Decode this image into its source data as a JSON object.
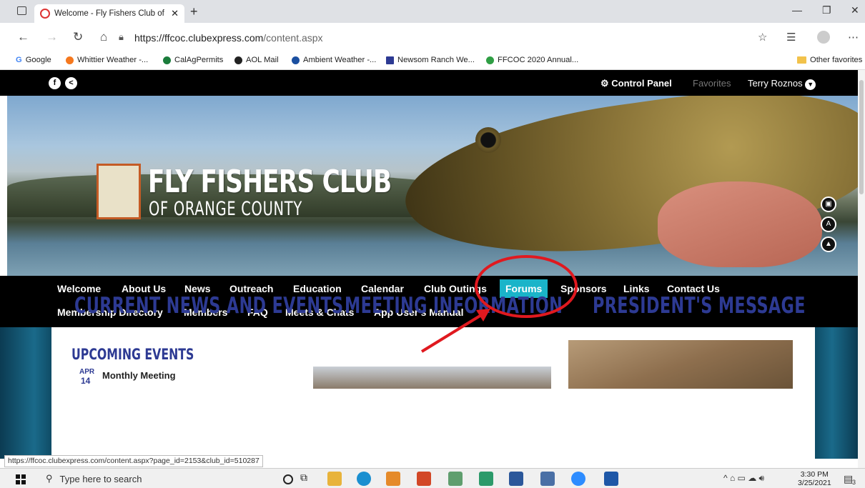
{
  "browser": {
    "tab_title": "Welcome - Fly Fishers Club of Or",
    "tab_close": "✕",
    "new_tab": "+",
    "url_host": "https://ffcoc.clubexpress.com",
    "url_path": "/content.aspx",
    "status_url": "https://ffcoc.clubexpress.com/content.aspx?page_id=2153&club_id=510287",
    "favorites": [
      {
        "label": "Google",
        "color": "#4285f4"
      },
      {
        "label": "Whittier Weather -...",
        "color": "#f5781e"
      },
      {
        "label": "CalAgPermits",
        "color": "#1a7c3b"
      },
      {
        "label": "AOL Mail",
        "color": "#222222"
      },
      {
        "label": "Ambient Weather -...",
        "color": "#1b4fa0"
      },
      {
        "label": "Newsom Ranch We...",
        "color": "#2d3a93"
      },
      {
        "label": "FFCOC 2020 Annual...",
        "color": "#2f9e44"
      }
    ],
    "other_favorites": "Other favorites"
  },
  "site": {
    "util": {
      "control_panel": "⚙ Control Panel",
      "favorites": "Favorites",
      "user": "Terry Roznos"
    },
    "logo_title": "FLY FISHERS CLUB",
    "logo_sub": "OF ORANGE COUNTY",
    "nav_row1": [
      "Welcome",
      "About Us",
      "News",
      "Outreach",
      "Education",
      "Calendar",
      "Club Outings",
      "Forums",
      "Sponsors",
      "Links",
      "Contact Us"
    ],
    "nav_row2": [
      "Membership Directory",
      "Members",
      "FAQ",
      "Meets & Chats",
      "App User's Manual"
    ],
    "active_nav": "Forums",
    "sections": {
      "news": "CURRENT NEWS AND EVENTS",
      "meeting": "MEETING INFORMATION",
      "president": "PRESIDENT'S MESSAGE"
    },
    "upcoming_events": "UPCOMING EVENTS",
    "event": {
      "month": "APR",
      "day": "14",
      "title": "Monthly Meeting"
    }
  },
  "taskbar": {
    "search_placeholder": "Type here to search",
    "time": "3:30 PM",
    "date": "3/25/2021",
    "notification_count": "3"
  },
  "colors": {
    "accent_nav": "#1ab4c9",
    "heading_blue": "#2d3a93",
    "annotation_red": "#e0191f"
  }
}
